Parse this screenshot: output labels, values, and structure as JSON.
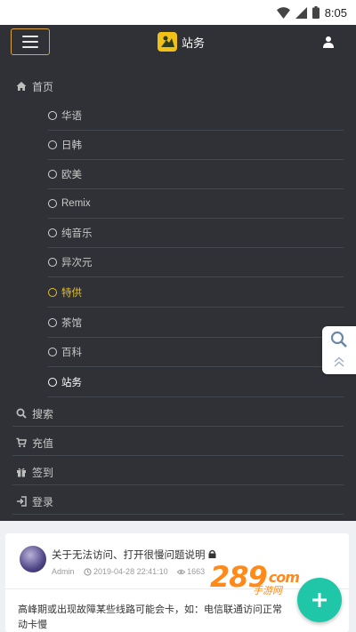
{
  "statusbar": {
    "time": "8:05",
    "icons": [
      "wifi-icon",
      "signal-icon",
      "battery-icon"
    ]
  },
  "header": {
    "site_name": "站务",
    "icons": [
      "menu-icon",
      "logo-icon",
      "user-icon"
    ]
  },
  "menu": {
    "home_label": "首页",
    "home_icon": "home-icon",
    "sub_items": [
      {
        "label": "华语",
        "state": "normal"
      },
      {
        "label": "日韩",
        "state": "normal"
      },
      {
        "label": "欧美",
        "state": "normal"
      },
      {
        "label": "Remix",
        "state": "normal"
      },
      {
        "label": "纯音乐",
        "state": "normal"
      },
      {
        "label": "异次元",
        "state": "normal"
      },
      {
        "label": "特供",
        "state": "highlighted"
      },
      {
        "label": "茶馆",
        "state": "normal"
      },
      {
        "label": "百科",
        "state": "normal"
      },
      {
        "label": "站务",
        "state": "current"
      }
    ],
    "search_label": "搜索",
    "recharge_label": "充值",
    "checkin_label": "签到",
    "login_label": "登录"
  },
  "float_tools": {
    "icons": [
      "search-icon",
      "scroll-top-icon"
    ]
  },
  "post": {
    "title": "关于无法访问、打开很慢问题说明",
    "title_icon": "lock-icon",
    "author": "Admin",
    "datetime": "2019-04-28 22:41:10",
    "views": "1663",
    "body": "高峰期或出现故障某些线路可能会卡，如：电信联通访问正常",
    "body_line2": "动卡慢"
  },
  "watermark": {
    "number": "289",
    "suffix": "com",
    "subtitle": "手游网"
  },
  "fab": {
    "icon": "plus-icon"
  },
  "colors": {
    "drawer_bg": "#2f3136",
    "accent_gold": "#e6c025",
    "menu_border": "#d9a441",
    "fab": "#1fc7a8",
    "watermark": "#ff8a1a"
  }
}
